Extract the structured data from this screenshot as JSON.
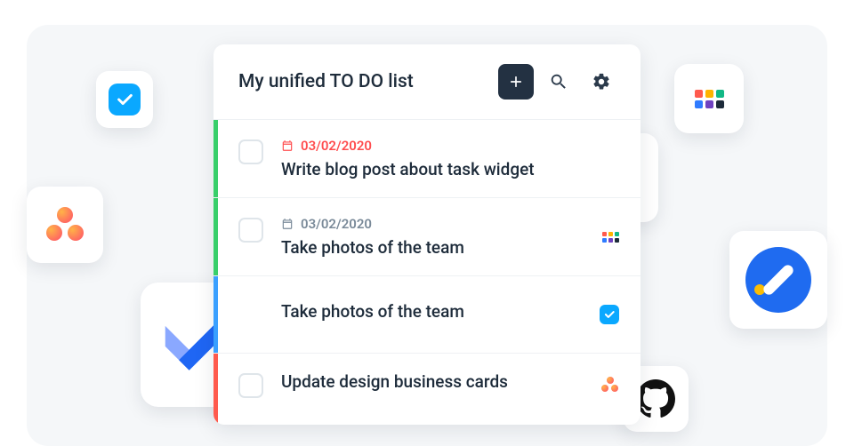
{
  "header": {
    "title": "My unified TO DO list"
  },
  "tasks": [
    {
      "date": "03/02/2020",
      "title": "Write blog post about task widget",
      "bar": "#38cf6a",
      "dateStyle": "red"
    },
    {
      "date": "03/02/2020",
      "title": "Take photos of the team",
      "bar": "#38cf6a",
      "dateStyle": "gray"
    },
    {
      "title": "Take photos of the team",
      "bar": "#3aa0ff"
    },
    {
      "title": "Update design business cards",
      "bar": "#ff5a4d"
    }
  ]
}
